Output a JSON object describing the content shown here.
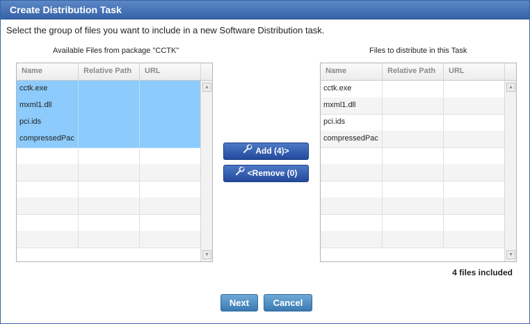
{
  "dialog": {
    "title": "Create Distribution Task",
    "instruction": "Select the group of files you want to include in a new Software Distribution task."
  },
  "available": {
    "caption": "Available Files from package \"CCTK\"",
    "columns": [
      "Name",
      "Relative Path",
      "URL"
    ],
    "rows": [
      {
        "name": "cctk.exe",
        "path": "",
        "url": "",
        "selected": true
      },
      {
        "name": "mxml1.dll",
        "path": "",
        "url": "",
        "selected": true
      },
      {
        "name": "pci.ids",
        "path": "",
        "url": "",
        "selected": true
      },
      {
        "name": "compressedPac",
        "path": "",
        "url": "",
        "selected": true
      }
    ]
  },
  "distribute": {
    "caption": "Files to distribute in this Task",
    "columns": [
      "Name",
      "Relative Path",
      "URL"
    ],
    "rows": [
      {
        "name": "cctk.exe",
        "path": "",
        "url": ""
      },
      {
        "name": "mxml1.dll",
        "path": "",
        "url": ""
      },
      {
        "name": "pci.ids",
        "path": "",
        "url": ""
      },
      {
        "name": "compressedPac",
        "path": "",
        "url": ""
      }
    ]
  },
  "actions": {
    "add_label": "Add (4)>",
    "remove_label": "<Remove (0)",
    "icon": "wrench-icon"
  },
  "status": {
    "files_included": "4 files included"
  },
  "footer": {
    "next_label": "Next",
    "cancel_label": "Cancel"
  },
  "colors": {
    "title_bar": "#3f6bb0",
    "selection": "#8ccbfb",
    "action_button": "#2b54a5",
    "footer_button": "#4f8cc4"
  }
}
